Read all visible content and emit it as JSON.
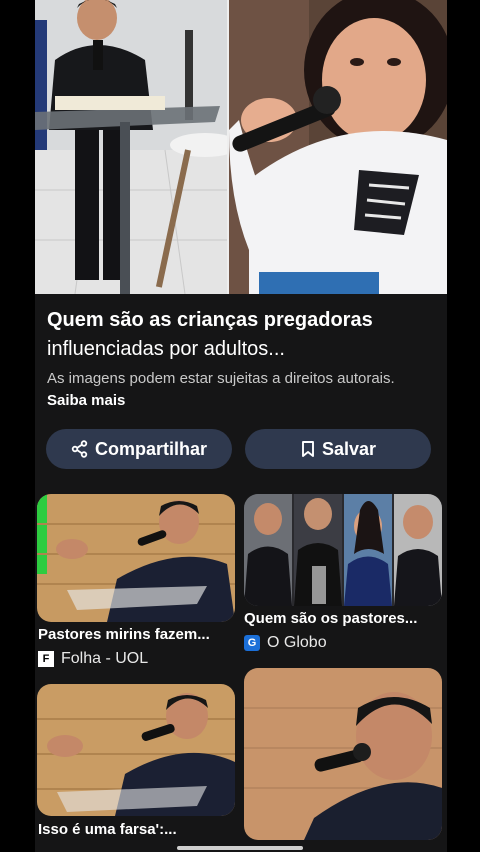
{
  "result": {
    "title_main": "Quem são as crianças pregadoras",
    "title_rest": "influenciadas por adultos...",
    "copyright_text": "As imagens podem estar sujeitas a direitos autorais.",
    "learn_more": "Saiba mais"
  },
  "actions": {
    "share_label": "Compartilhar",
    "save_label": "Salvar"
  },
  "related": [
    {
      "caption": "Pastores mirins fazem...",
      "source": "Folha - UOL",
      "source_logo": "F"
    },
    {
      "caption": "Quem são os pastores...",
      "source": "O Globo",
      "source_logo": "G"
    },
    {
      "caption": "Isso é uma farsa':...",
      "source": "",
      "source_logo": ""
    }
  ],
  "colors": {
    "button_bg": "#2f394e",
    "panel_bg": "#151516",
    "globo_blue": "#1b6fd8"
  }
}
